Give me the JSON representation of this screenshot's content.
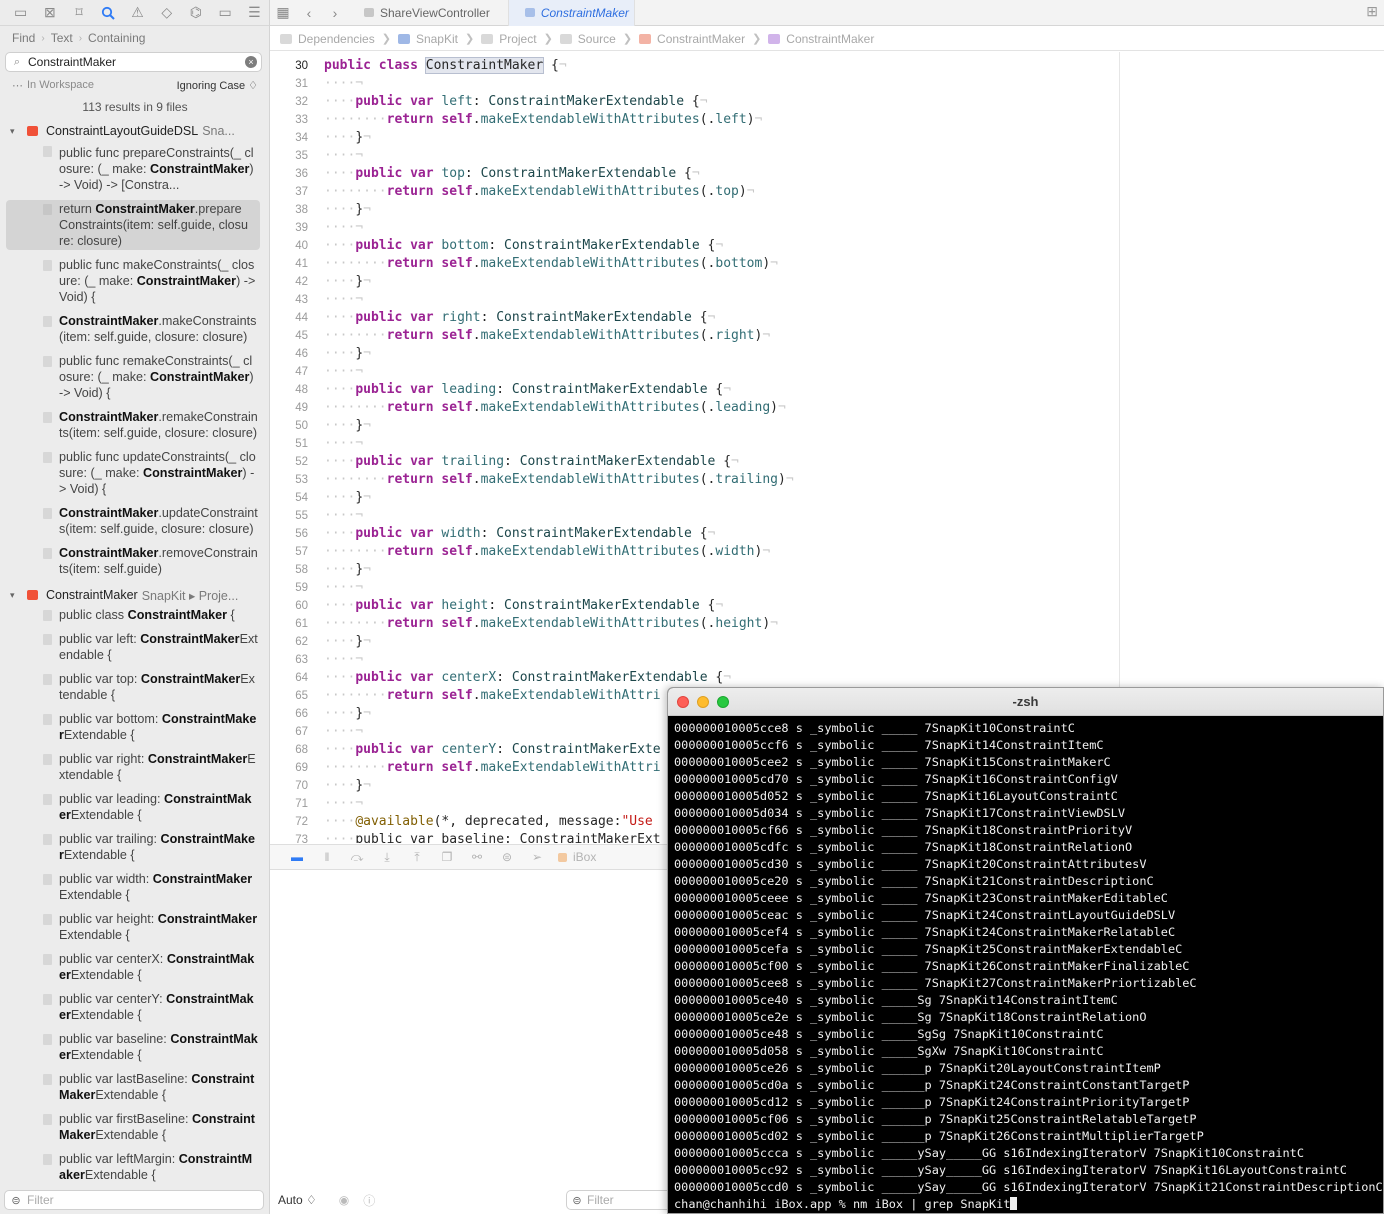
{
  "navigator": {
    "icons": [
      "folder-icon",
      "x-square-icon",
      "bookmark-icon",
      "search-icon",
      "warning-icon",
      "diamond-icon",
      "sprayer-icon",
      "tag-icon",
      "list-icon"
    ],
    "find_crumbs": [
      "Find",
      "Text",
      "Containing"
    ],
    "search_value": "ConstraintMaker",
    "scope": "In Workspace",
    "case_mode": "Ignoring Case ♢",
    "results_count": "113 results in 9 files",
    "files": [
      {
        "name": "ConstraintLayoutGuideDSL",
        "path": "Sna...",
        "matches": [
          {
            "before": "public func prepareConstraints(_ closure: (_ make: ",
            "bold": "ConstraintMaker",
            "after": ") -> Void) -> [Constra..."
          },
          {
            "before": "return ",
            "bold": "ConstraintMaker",
            "after": ".prepareConstraints(item: self.guide, closure: closure)"
          },
          {
            "before": "public func makeConstraints(_ closure: (_ make: ",
            "bold": "ConstraintMaker",
            "after": ") -> Void) {"
          },
          {
            "before": "",
            "bold": "ConstraintMaker",
            "after": ".makeConstraints(item: self.guide, closure: closure)"
          },
          {
            "before": "public func remakeConstraints(_ closure: (_ make: ",
            "bold": "ConstraintMaker",
            "after": ") -> Void) {"
          },
          {
            "before": "",
            "bold": "ConstraintMaker",
            "after": ".remakeConstraints(item: self.guide, closure: closure)"
          },
          {
            "before": "public func updateConstraints(_ closure: (_ make: ",
            "bold": "ConstraintMaker",
            "after": ") -> Void) {"
          },
          {
            "before": "",
            "bold": "ConstraintMaker",
            "after": ".updateConstraints(item: self.guide, closure: closure)"
          },
          {
            "before": "",
            "bold": "ConstraintMaker",
            "after": ".removeConstraints(item: self.guide)"
          }
        ]
      },
      {
        "name": "ConstraintMaker",
        "path": "SnapKit ▸ Proje...",
        "matches": [
          {
            "before": "public class ",
            "bold": "ConstraintMaker",
            "after": " {"
          },
          {
            "before": "public var left: ",
            "bold": "ConstraintMaker",
            "after": "Extendable {"
          },
          {
            "before": "public var top: ",
            "bold": "ConstraintMaker",
            "after": "Extendable {"
          },
          {
            "before": "public var bottom: ",
            "bold": "ConstraintMaker",
            "after": "Extendable {"
          },
          {
            "before": "public var right: ",
            "bold": "ConstraintMaker",
            "after": "Extendable {"
          },
          {
            "before": "public var leading: ",
            "bold": "ConstraintMaker",
            "after": "Extendable {"
          },
          {
            "before": "public var trailing: ",
            "bold": "ConstraintMaker",
            "after": "Extendable {"
          },
          {
            "before": "public var width: ",
            "bold": "ConstraintMaker",
            "after": "Extendable {"
          },
          {
            "before": "public var height: ",
            "bold": "ConstraintMaker",
            "after": "Extendable {"
          },
          {
            "before": "public var centerX: ",
            "bold": "ConstraintMaker",
            "after": "Extendable {"
          },
          {
            "before": "public var centerY: ",
            "bold": "ConstraintMaker",
            "after": "Extendable {"
          },
          {
            "before": "public var baseline: ",
            "bold": "ConstraintMaker",
            "after": "Extendable {"
          },
          {
            "before": "public var lastBaseline: ",
            "bold": "ConstraintMaker",
            "after": "Extendable {"
          },
          {
            "before": "public var firstBaseline: ",
            "bold": "ConstraintMaker",
            "after": "Extendable {"
          },
          {
            "before": "public var leftMargin: ",
            "bold": "ConstraintMaker",
            "after": "Extendable {"
          }
        ]
      }
    ],
    "filter_placeholder": "Filter"
  },
  "tabs": [
    {
      "label": "ShareViewController",
      "active": false
    },
    {
      "label": "ConstraintMaker",
      "active": true
    }
  ],
  "jumpbar": [
    {
      "label": "Dependencies",
      "icon": "folder-icon"
    },
    {
      "label": "SnapKit",
      "icon": "app-icon"
    },
    {
      "label": "Project",
      "icon": "folder-icon"
    },
    {
      "label": "Source",
      "icon": "folder-icon"
    },
    {
      "label": "ConstraintMaker",
      "icon": "swift-file-icon"
    },
    {
      "label": "ConstraintMaker",
      "icon": "class-icon"
    }
  ],
  "editor": {
    "current_line": 30,
    "props": [
      "left",
      "top",
      "bottom",
      "right",
      "leading",
      "trailing",
      "width",
      "height",
      "centerX"
    ],
    "class_decl": {
      "kw1": "public",
      "kw2": "class",
      "name": "ConstraintMaker",
      "brace": " {"
    },
    "extendable_type": "ConstraintMakerExtendable",
    "method_call": "makeExtendableWithAttributes",
    "line68_text": "ConstraintMakerExte",
    "line69_text": "makeExtendableWithAttri",
    "line65_text": "makeExtendableWithAttri",
    "line72": {
      "attr": "@available",
      "args": "(*, deprecated, message:",
      "str": "\"Use"
    },
    "line73": "public var baseline: ConstraintMakerExt"
  },
  "debug": {
    "target": "iBox"
  },
  "bottom": {
    "mode": "Auto ♢",
    "filter_placeholder": "Filter"
  },
  "terminal": {
    "title": "-zsh",
    "lines": [
      "000000010005cce8 s _symbolic _____ 7SnapKit10ConstraintC",
      "000000010005ccf6 s _symbolic _____ 7SnapKit14ConstraintItemC",
      "000000010005cee2 s _symbolic _____ 7SnapKit15ConstraintMakerC",
      "000000010005cd70 s _symbolic _____ 7SnapKit16ConstraintConfigV",
      "000000010005d052 s _symbolic _____ 7SnapKit16LayoutConstraintC",
      "000000010005d034 s _symbolic _____ 7SnapKit17ConstraintViewDSLV",
      "000000010005cf66 s _symbolic _____ 7SnapKit18ConstraintPriorityV",
      "000000010005cdfc s _symbolic _____ 7SnapKit18ConstraintRelationO",
      "000000010005cd30 s _symbolic _____ 7SnapKit20ConstraintAttributesV",
      "000000010005ce20 s _symbolic _____ 7SnapKit21ConstraintDescriptionC",
      "000000010005ceee s _symbolic _____ 7SnapKit23ConstraintMakerEditableC",
      "000000010005ceac s _symbolic _____ 7SnapKit24ConstraintLayoutGuideDSLV",
      "000000010005cef4 s _symbolic _____ 7SnapKit24ConstraintMakerRelatableC",
      "000000010005cefa s _symbolic _____ 7SnapKit25ConstraintMakerExtendableC",
      "000000010005cf00 s _symbolic _____ 7SnapKit26ConstraintMakerFinalizableC",
      "000000010005cee8 s _symbolic _____ 7SnapKit27ConstraintMakerPriortizableC",
      "000000010005ce40 s _symbolic _____Sg 7SnapKit14ConstraintItemC",
      "000000010005ce2e s _symbolic _____Sg 7SnapKit18ConstraintRelationO",
      "000000010005ce48 s _symbolic _____SgSg 7SnapKit10ConstraintC",
      "000000010005d058 s _symbolic _____SgXw 7SnapKit10ConstraintC",
      "000000010005ce26 s _symbolic ______p 7SnapKit20LayoutConstraintItemP",
      "000000010005cd0a s _symbolic ______p 7SnapKit24ConstraintConstantTargetP",
      "000000010005cd12 s _symbolic ______p 7SnapKit24ConstraintPriorityTargetP",
      "000000010005cf06 s _symbolic ______p 7SnapKit25ConstraintRelatableTargetP",
      "000000010005cd02 s _symbolic ______p 7SnapKit26ConstraintMultiplierTargetP",
      "000000010005ccca s _symbolic _____ySay_____GG s16IndexingIteratorV 7SnapKit10ConstraintC",
      "000000010005cc92 s _symbolic _____ySay_____GG s16IndexingIteratorV 7SnapKit16LayoutConstraintC",
      "000000010005ccd0 s _symbolic _____ySay_____GG s16IndexingIteratorV 7SnapKit21ConstraintDescriptionC"
    ],
    "prompt": "chan@chanhihi iBox.app % nm iBox | grep SnapKit"
  }
}
